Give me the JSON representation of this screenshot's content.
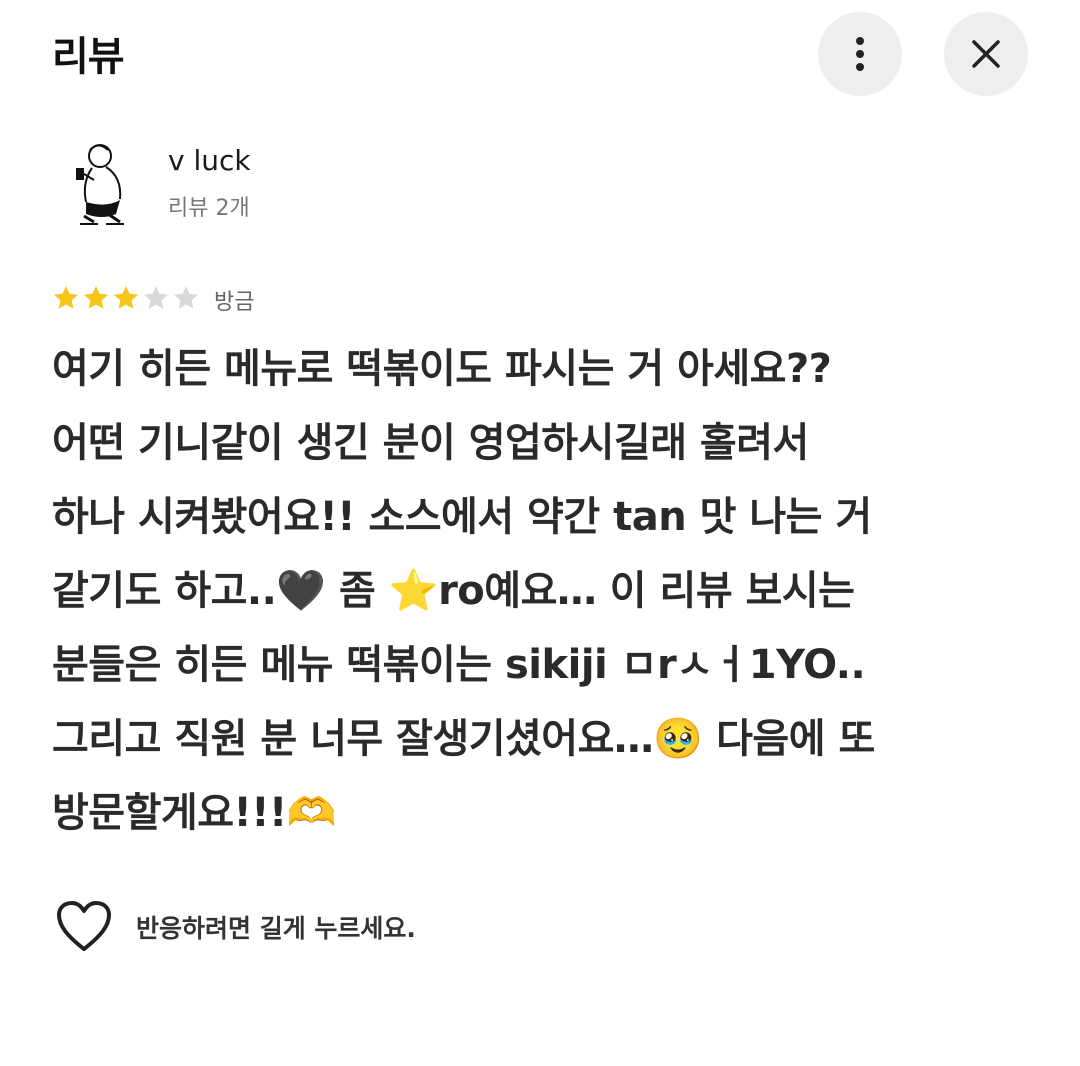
{
  "header": {
    "title": "리뷰",
    "more_icon": "more-vertical-icon",
    "close_icon": "close-icon"
  },
  "user": {
    "name": "v luck",
    "review_count": "리뷰 2개",
    "avatar_icon": "drawn-person-avatar"
  },
  "review": {
    "rating": 3,
    "max_rating": 5,
    "time": "방금",
    "lines": [
      "여기 히든 메뉴로 떡볶이도 파시는 거 아세요??",
      "어떤 기니같이 생긴 분이 영업하시길래 홀려서",
      "하나 시켜봤어요!! 소스에서 약간 tan 맛 나는 거",
      "같기도 하고..🖤 좀 ⭐ro예요… 이 리뷰 보시는",
      "분들은 히든 메뉴 떡볶이는 sikiji ㅁrㅅㅓ1YO..",
      "그리고 직원 분 너무 잘생기셨어요…🥹 다음에 또",
      "방문할게요!!!🫶"
    ]
  },
  "reaction": {
    "hint": "반응하려면 길게 누르세요.",
    "icon": "heart-outline-icon"
  },
  "colors": {
    "star_filled": "#F5C518",
    "star_empty": "#D9D9D9",
    "button_bg": "#EEEEEE"
  }
}
